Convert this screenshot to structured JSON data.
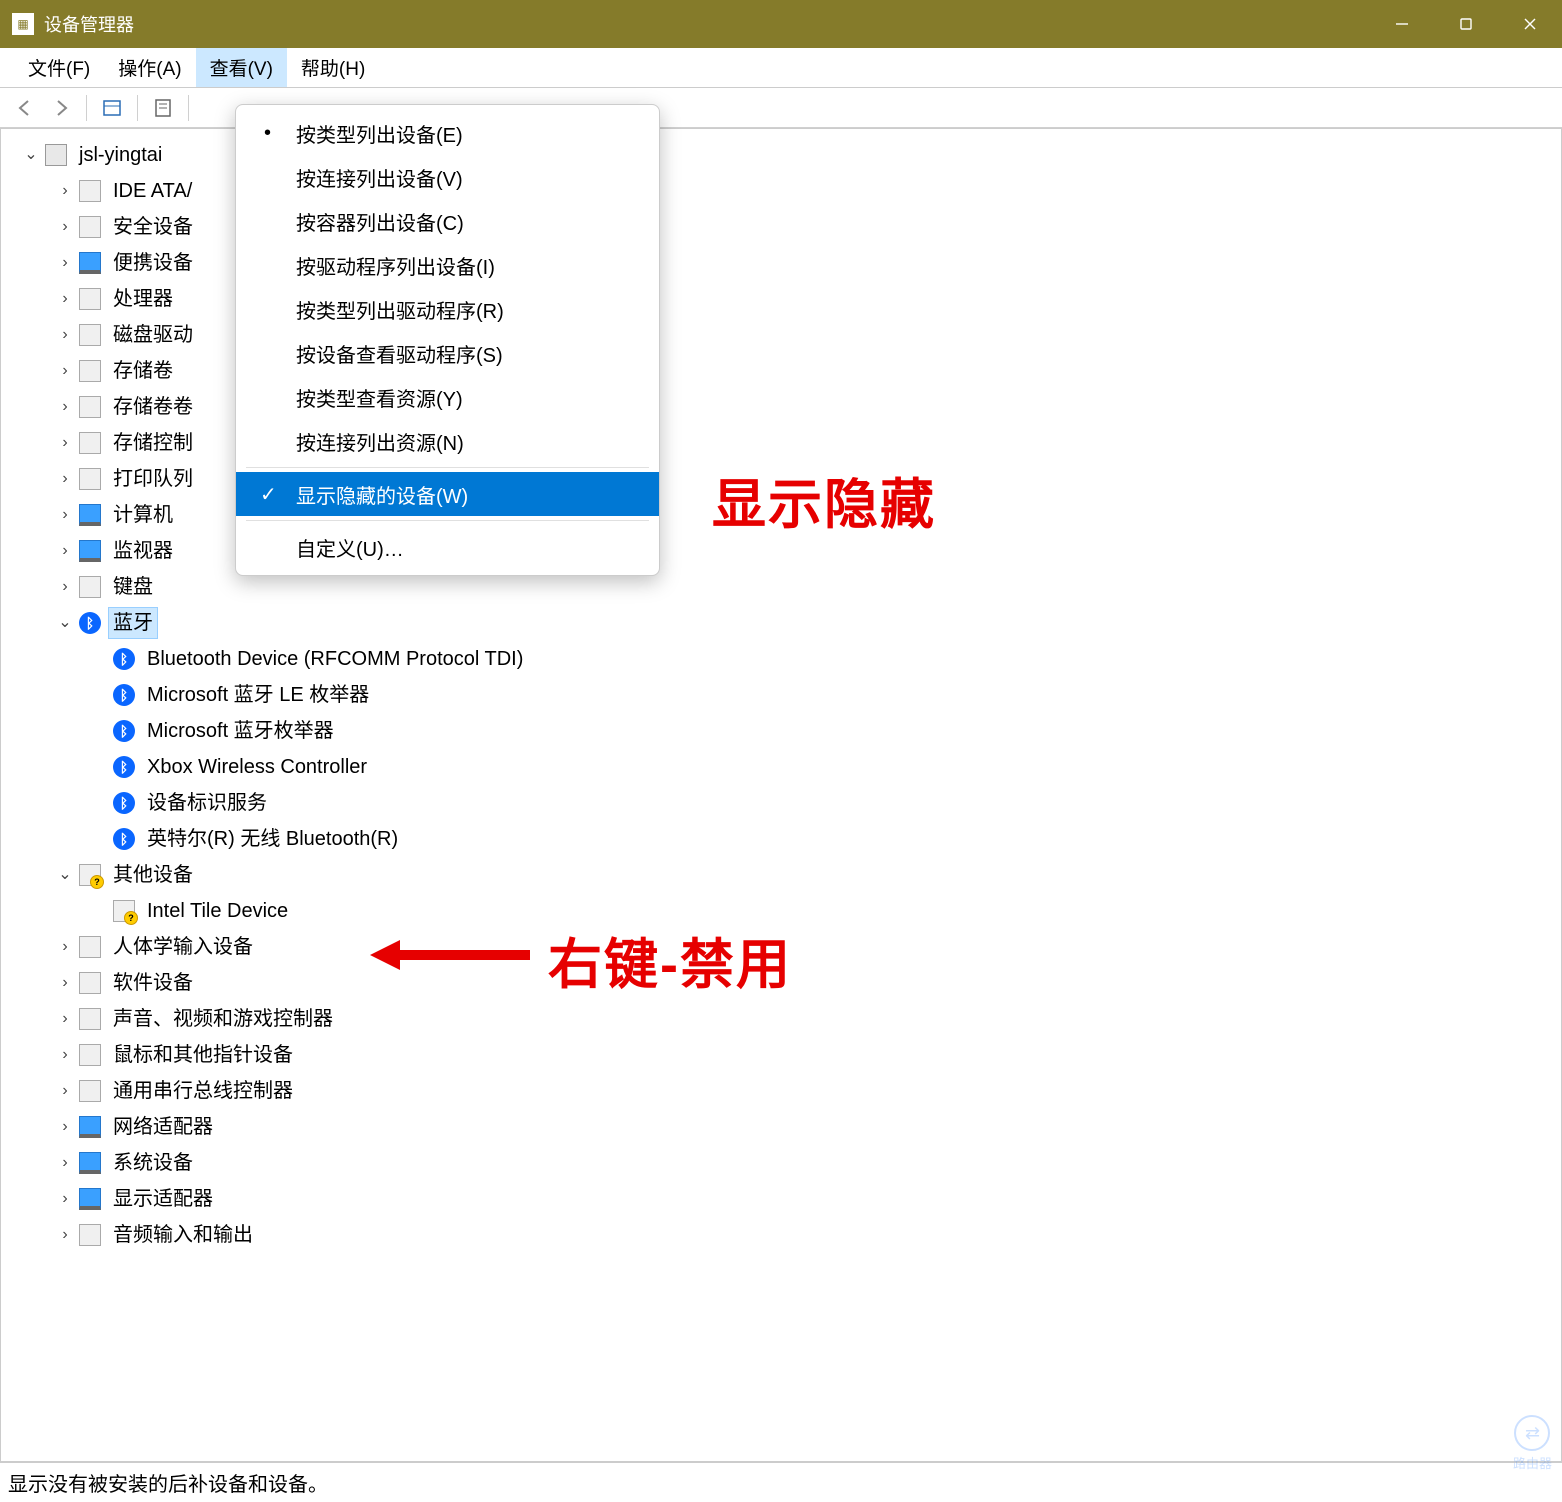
{
  "window": {
    "title": "设备管理器"
  },
  "menu": {
    "file": "文件(F)",
    "action": "操作(A)",
    "view": "查看(V)",
    "help": "帮助(H)"
  },
  "dropdown": {
    "devByType": "按类型列出设备(E)",
    "devByConn": "按连接列出设备(V)",
    "devByCont": "按容器列出设备(C)",
    "devByDrv": "按驱动程序列出设备(I)",
    "drvByType": "按类型列出驱动程序(R)",
    "drvByDev": "按设备查看驱动程序(S)",
    "resByType": "按类型查看资源(Y)",
    "resByConn": "按连接列出资源(N)",
    "showHidden": "显示隐藏的设备(W)",
    "customize": "自定义(U)…"
  },
  "tree": {
    "root": "jsl-yingtai",
    "ide": "IDE ATA/",
    "security": "安全设备",
    "portable": "便携设备",
    "cpu": "处理器",
    "disk": "磁盘驱动",
    "volume": "存储卷",
    "volshadow": "存储卷卷",
    "storagectrl": "存储控制",
    "printq": "打印队列",
    "computer": "计算机",
    "monitor": "监视器",
    "keyboard": "键盘",
    "bluetooth": "蓝牙",
    "bt_rfcomm": "Bluetooth Device (RFCOMM Protocol TDI)",
    "bt_msle": "Microsoft 蓝牙 LE 枚举器",
    "bt_msenum": "Microsoft 蓝牙枚举器",
    "bt_xbox": "Xbox Wireless Controller",
    "bt_idservice": "设备标识服务",
    "bt_intel": "英特尔(R) 无线 Bluetooth(R)",
    "other": "其他设备",
    "other_intel": "Intel Tile Device",
    "hid": "人体学输入设备",
    "softdev": "软件设备",
    "sound": "声音、视频和游戏控制器",
    "mouse": "鼠标和其他指针设备",
    "usb": "通用串行总线控制器",
    "network": "网络适配器",
    "system": "系统设备",
    "display": "显示适配器",
    "audioio": "音频输入和输出"
  },
  "annotations": {
    "showHidden": "显示隐藏",
    "rightClickDisable": "右键-禁用"
  },
  "statusbar": "显示没有被安装的后补设备和设备。",
  "watermark": "路由器"
}
